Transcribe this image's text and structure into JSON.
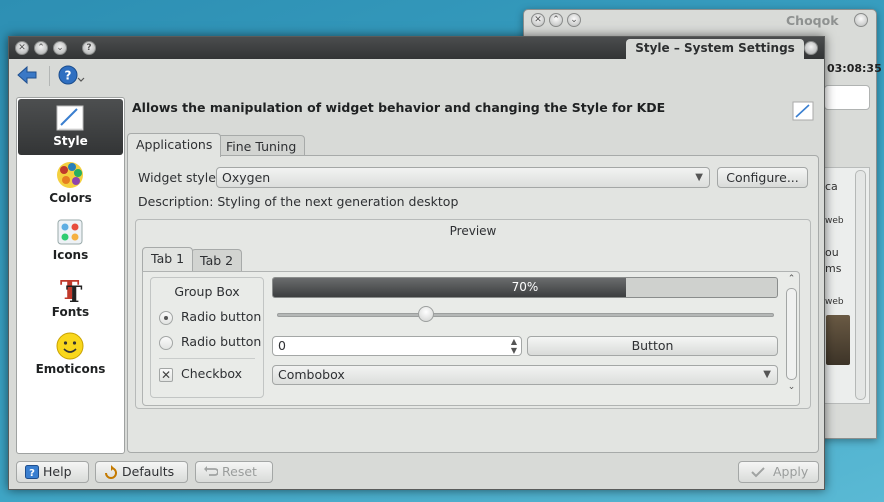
{
  "background_window": {
    "title": "Choqok",
    "time": "03:08:35",
    "snippets": [
      "ca",
      "web",
      "ou",
      "ms",
      "web"
    ]
  },
  "window": {
    "title": "Style – System Settings",
    "title_buttons": [
      "close-icon",
      "maximize-icon",
      "minimize-icon",
      "help-icon"
    ]
  },
  "toolbar": {
    "back_icon": "back-arrow-icon",
    "help_icon": "help-menu-icon"
  },
  "sidebar": {
    "items": [
      {
        "label": "Style",
        "icon": "style-icon",
        "active": true
      },
      {
        "label": "Colors",
        "icon": "colors-icon",
        "active": false
      },
      {
        "label": "Icons",
        "icon": "icons-icon",
        "active": false
      },
      {
        "label": "Fonts",
        "icon": "fonts-icon",
        "active": false
      },
      {
        "label": "Emoticons",
        "icon": "emoticons-icon",
        "active": false
      }
    ]
  },
  "header": {
    "description": "Allows the manipulation of widget behavior and changing the Style for KDE"
  },
  "tabs": [
    "Applications",
    "Fine Tuning"
  ],
  "applications": {
    "widget_style_label": "Widget style:",
    "widget_style_value": "Oxygen",
    "configure_label": "Configure...",
    "description_text": "Description: Styling of the next generation desktop",
    "preview": {
      "title": "Preview",
      "tabs": [
        "Tab 1",
        "Tab 2"
      ],
      "group_box_title": "Group Box",
      "radio1": "Radio button",
      "radio2": "Radio button",
      "checkbox": "Checkbox",
      "progress": 0.7,
      "progress_text": "70%",
      "slider_value": 0.3,
      "spinbox_value": "0",
      "button_label": "Button",
      "combobox_value": "Combobox"
    }
  },
  "bottom": {
    "help": "Help",
    "defaults": "Defaults",
    "reset": "Reset",
    "apply": "Apply"
  }
}
